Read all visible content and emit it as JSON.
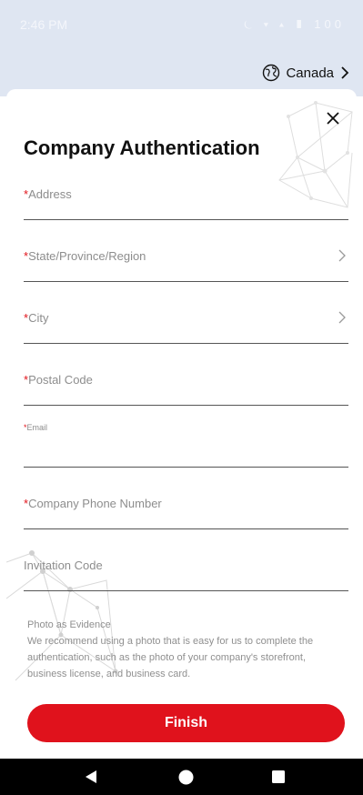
{
  "status_bar": {
    "time": "2:46 PM",
    "icons": "⏾ ▾ ▴ ▮ 100"
  },
  "region": {
    "country": "Canada"
  },
  "form": {
    "title": "Company Authentication",
    "required_mark": "*",
    "fields": [
      {
        "label": "Address",
        "required": true,
        "value": ""
      },
      {
        "label": "State/Province/Region",
        "required": true,
        "value": ""
      },
      {
        "label": "City",
        "required": true,
        "value": ""
      },
      {
        "label": "Postal Code",
        "required": true,
        "value": ""
      },
      {
        "label": "Email",
        "required": true,
        "value": ""
      },
      {
        "label": "Company Phone Number",
        "required": true,
        "value": ""
      },
      {
        "label": "Invitation Code",
        "required": false,
        "value": ""
      }
    ],
    "evidence_title": "Photo as Evidence",
    "evidence_text": "We recommend using a photo that is easy for us to complete the authentication, such as the photo of your company's storefront, business license, and business card.",
    "finish_label": "Finish"
  },
  "colors": {
    "accent": "#e0121c",
    "header_bg": "#dfe6f2"
  },
  "icons": [
    "globe-icon",
    "chevron-right-icon",
    "close-icon",
    "back-icon",
    "home-icon",
    "recents-icon"
  ]
}
